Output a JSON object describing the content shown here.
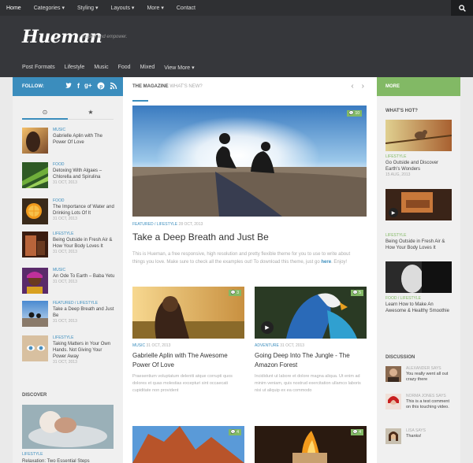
{
  "topnav": {
    "items": [
      "Home",
      "Categories ▾",
      "Styling ▾",
      "Layouts ▾",
      "More ▾",
      "Contact"
    ]
  },
  "header": {
    "logo": "Hueman",
    "tagline": "Inspire and empower.",
    "nav": [
      "Post Formats",
      "Lifestyle",
      "Music",
      "Food",
      "Mixed",
      "View More ▾"
    ]
  },
  "follow": {
    "label": "FOLLOW:"
  },
  "more": {
    "label": "MORE"
  },
  "left": {
    "tabs": [
      "clock-icon",
      "star-icon"
    ],
    "posts": [
      {
        "cat": "MUSIC",
        "title": "Gabrielle Aplin with The Power Of Love",
        "date": ""
      },
      {
        "cat": "FOOD",
        "title": "Detoxing With Algaes – Chlorella and Spirulina",
        "date": "31 OCT, 2013"
      },
      {
        "cat": "FOOD",
        "title": "The Importance of Water and Drinking Lots Of It",
        "date": "31 OCT, 2013"
      },
      {
        "cat": "LIFESTYLE",
        "title": "Being Outside in Fresh Air & How Your Body Loves It",
        "date": "31 OCT, 2013"
      },
      {
        "cat": "MUSIC",
        "title": "An Ode To Earth – Baba Yetu",
        "date": "31 OCT, 2013"
      },
      {
        "cat": "FEATURED / LIFESTYLE",
        "title": "Take a Deep Breath and Just Be",
        "date": "31 OCT, 2013"
      },
      {
        "cat": "LIFESTYLE",
        "title": "Taking Matters in Your Own Hands. Not Giving Your Power Away",
        "date": "31 OCT, 2013"
      }
    ],
    "discover": {
      "title": "DISCOVER",
      "cat": "LIFESTYLE",
      "post": "Relaxation: Two Essential Steps"
    }
  },
  "magazine": {
    "title": "THE MAGAZINE",
    "subtitle": "WHAT'S NEW?",
    "featured": {
      "badge": "10",
      "cat": "FEATURED / LIFESTYLE",
      "date": "28 OCT, 2013",
      "title": "Take a Deep Breath and Just Be",
      "excerpt": "This is Hueman, a free responsive, high resolution and pretty flexible theme for you to use to write about things you love. Make sure to check all the examples out! To download this theme, just go",
      "link": "here",
      "excerpt_end": ". Enjoy!"
    },
    "cards": [
      {
        "badge": "3",
        "cat": "MUSIC",
        "date": "31 OCT, 2013",
        "title": "Gabrielle Aplin with The Awesome Power Of Love",
        "excerpt": "Praesentium voluptatum deleniti atque corrupti quos dolores et quas molestias excepturi sint occaecati cupiditate non provident"
      },
      {
        "badge": "5",
        "cat": "ADVENTURE",
        "date": "31 OCT, 2013",
        "title": "Going Deep Into The Jungle - The Amazon Forest",
        "excerpt": "Incididunt ut labore et dolore magna aliqua. Ut enim ad minim veniam, quis nostrud exercitation ullamco laboris nisi ut aliquip ex ea commodo"
      },
      {
        "badge": "4"
      },
      {
        "badge": "4"
      }
    ]
  },
  "right": {
    "hot_title": "WHAT'S HOT?",
    "posts": [
      {
        "cat": "LIFESTYLE",
        "title": "Go Outside and Discover Earth's Wonders",
        "date": "15 AUG, 2013"
      },
      {
        "cat": "LIFESTYLE",
        "title": "Being Outside in Fresh Air & How Your Body Loves It",
        "date": ""
      },
      {
        "cat": "FOOD / LIFESTYLE",
        "title": "Learn How to Make An Awesome & Healthy Smoothie",
        "date": ""
      }
    ],
    "discussion_title": "DISCUSSION",
    "comments": [
      {
        "who": "ALEXANDER SAYS",
        "text": "You really went all out crazy there"
      },
      {
        "who": "NORMA JONES SAYS",
        "text": "This is a test comment on this touching video."
      },
      {
        "who": "LISA SAYS",
        "text": "Thanks!"
      }
    ]
  },
  "colors": {
    "blue": "#3b8dbd",
    "green": "#82b965",
    "dark": "#36373b"
  }
}
